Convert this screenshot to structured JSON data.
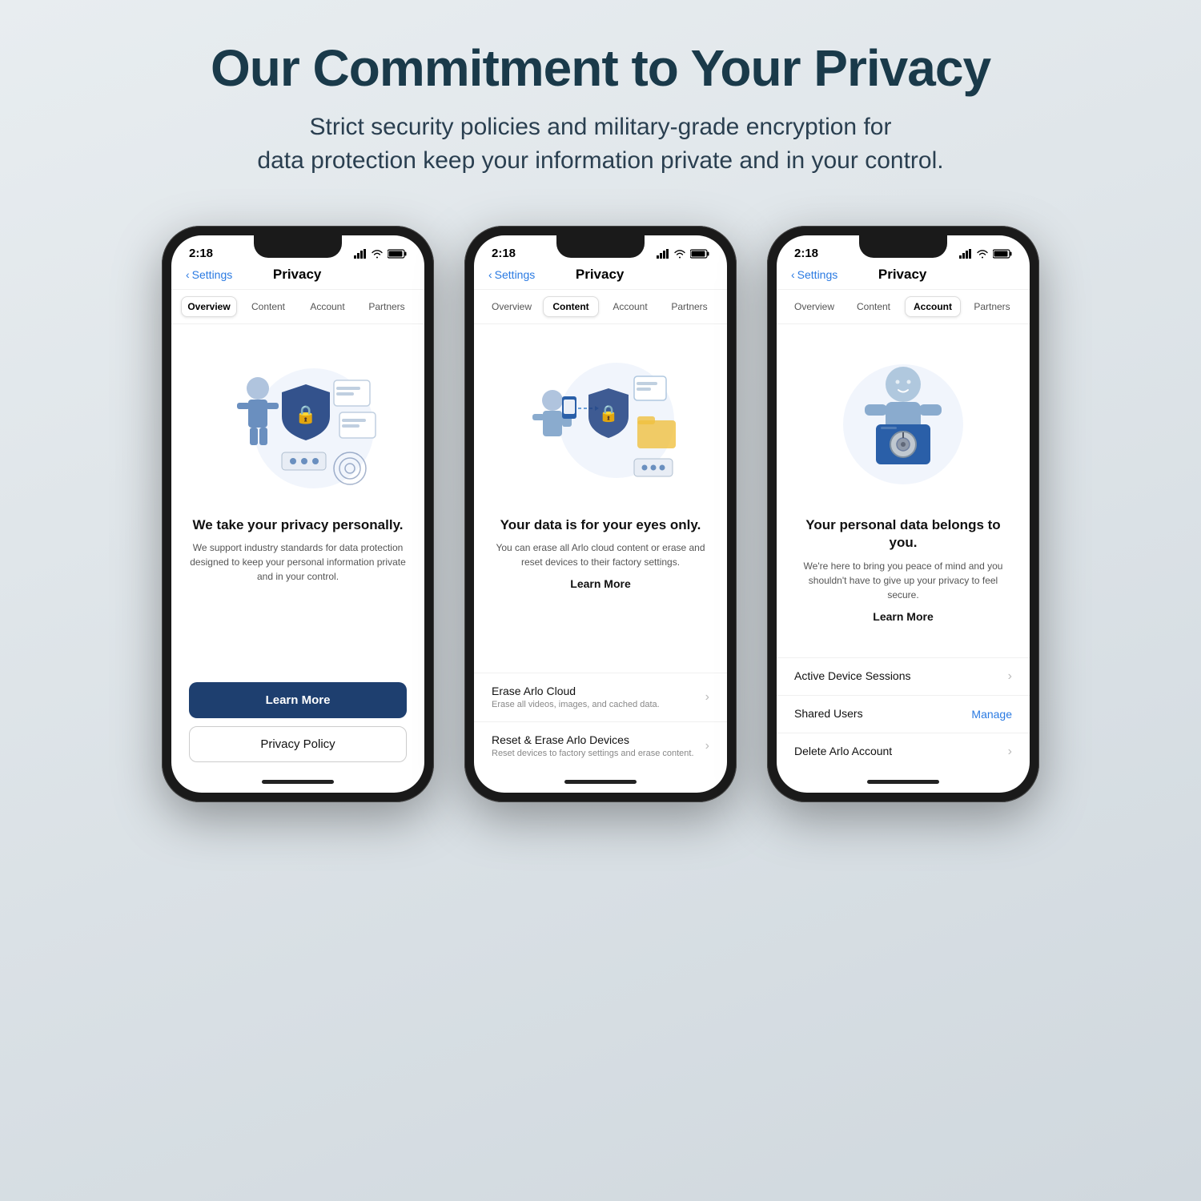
{
  "page": {
    "title": "Our Commitment to Your Privacy",
    "subtitle": "Strict security policies and military-grade encryption for\ndata protection keep your information private and in your control."
  },
  "phones": [
    {
      "id": "phone-overview",
      "status_time": "2:18",
      "nav_back": "Settings",
      "nav_title": "Privacy",
      "tabs": [
        "Overview",
        "Content",
        "Account",
        "Partners"
      ],
      "active_tab": "Overview",
      "content_title": "We take your privacy personally.",
      "content_desc": "We support industry standards for data protection designed to keep your personal information private and in your control.",
      "primary_button": "Learn More",
      "secondary_button": "Privacy Policy"
    },
    {
      "id": "phone-content",
      "status_time": "2:18",
      "nav_back": "Settings",
      "nav_title": "Privacy",
      "tabs": [
        "Overview",
        "Content",
        "Account",
        "Partners"
      ],
      "active_tab": "Content",
      "content_title": "Your data is for your eyes only.",
      "content_desc": "You can erase all Arlo cloud content or erase and reset devices to their factory settings.",
      "learn_more": "Learn More",
      "list_items": [
        {
          "title": "Erase Arlo Cloud",
          "desc": "Erase all videos, images, and cached data.",
          "action": "chevron"
        },
        {
          "title": "Reset & Erase Arlo Devices",
          "desc": "Reset devices to factory settings and erase content.",
          "action": "chevron"
        }
      ]
    },
    {
      "id": "phone-account",
      "status_time": "2:18",
      "nav_back": "Settings",
      "nav_title": "Privacy",
      "tabs": [
        "Overview",
        "Content",
        "Account",
        "Partners"
      ],
      "active_tab": "Account",
      "content_title": "Your personal data belongs to you.",
      "content_desc": "We're here to bring you peace of mind and you shouldn't have to give up your privacy to feel secure.",
      "learn_more": "Learn More",
      "list_items": [
        {
          "title": "Active Device Sessions",
          "desc": "",
          "action": "chevron"
        },
        {
          "title": "Shared Users",
          "desc": "",
          "action": "Manage"
        },
        {
          "title": "Delete Arlo Account",
          "desc": "",
          "action": "chevron"
        }
      ]
    }
  ]
}
